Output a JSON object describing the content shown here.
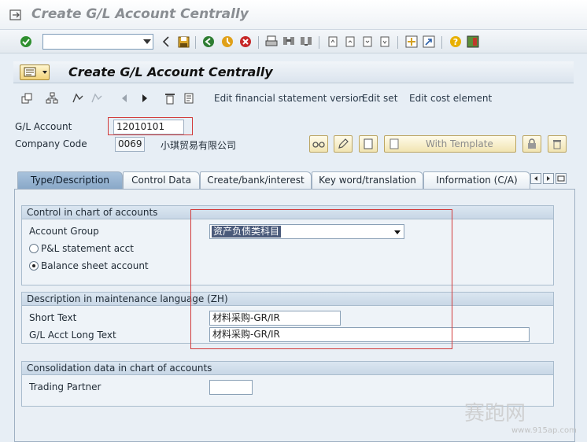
{
  "window": {
    "title": "Create G/L Account Centrally"
  },
  "system_toolbar": {
    "command_field_value": ""
  },
  "transaction": {
    "title": "Create G/L Account Centrally"
  },
  "app_toolbar": {
    "edit_fs_version": "Edit financial statement version",
    "edit_set": "Edit set",
    "edit_cost_element": "Edit cost element"
  },
  "header": {
    "gl_account_label": "G/L Account",
    "gl_account_value": "12010101",
    "company_code_label": "Company Code",
    "company_code_value": "0069",
    "company_name": "小琪贸易有限公司",
    "with_template_label": "With Template"
  },
  "tabs": [
    {
      "label": "Type/Description",
      "active": true
    },
    {
      "label": "Control Data",
      "active": false
    },
    {
      "label": "Create/bank/interest",
      "active": false
    },
    {
      "label": "Key word/translation",
      "active": false
    },
    {
      "label": "Information (C/A)",
      "active": false
    }
  ],
  "control_group": {
    "title": "Control in chart of accounts",
    "account_group_label": "Account Group",
    "account_group_value": "资产负债类科目",
    "pl_label": "P&L statement acct",
    "bs_label": "Balance sheet account",
    "selected": "balance_sheet"
  },
  "description_group": {
    "title": "Description in maintenance language (ZH)",
    "short_text_label": "Short Text",
    "short_text_value": "材料采购-GR/IR",
    "long_text_label": "G/L Acct Long Text",
    "long_text_value": "材料采购-GR/IR"
  },
  "consolidation_group": {
    "title": "Consolidation data in chart of accounts",
    "trading_partner_label": "Trading Partner",
    "trading_partner_value": ""
  },
  "watermark": {
    "text": "赛跑网",
    "url": "www.915ap.com"
  },
  "colors": {
    "accent": "#d23a3a",
    "active_tab": "#89a8c8"
  }
}
